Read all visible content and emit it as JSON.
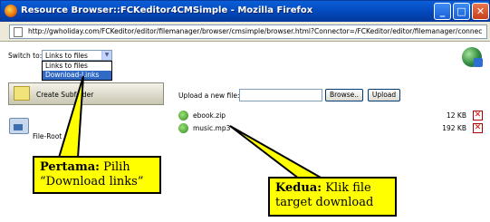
{
  "window": {
    "title": "Resource Browser::FCKeditor4CMSimple - Mozilla Firefox",
    "minimize_label": "_",
    "maximize_label": "□",
    "close_label": "✕"
  },
  "urlbar": {
    "url": "http://gwholiday.com/FCKeditor/editor/filemanager/browser/cmsimple/browser.html?Connector=/FCKeditor/editor/filemanager/connec"
  },
  "switcher": {
    "label": "Switch to:",
    "selected": "Links to files",
    "options": [
      "Links to files",
      "Download-Links"
    ],
    "highlighted_index": 1
  },
  "left_panel": {
    "create_subfolder_label": "Create Subfolder",
    "root_folder_label": "File-Root"
  },
  "upload": {
    "label": "Upload a new file:",
    "file_value": "",
    "browse_label": "Browse..",
    "upload_label": "Upload"
  },
  "files": [
    {
      "name": "ebook.zip",
      "size": "12 KB"
    },
    {
      "name": "music.mp3",
      "size": "192 KB"
    }
  ],
  "callouts": {
    "first": {
      "bold": "Pertama:",
      "text_line1": " Pilih",
      "text_line2": "“Download links”"
    },
    "second": {
      "bold": "Kedua:",
      "text_line1": " Klik file",
      "text_line2": "target download"
    }
  },
  "colors": {
    "titlebar": "#0347b9",
    "callout": "#ffff00",
    "selection": "#316ac5"
  },
  "icons": {
    "app": "firefox-icon",
    "page": "page-icon",
    "globe": "globe-icon",
    "folder": "folder-icon",
    "file": "file-download-icon",
    "delete": "delete-icon"
  }
}
